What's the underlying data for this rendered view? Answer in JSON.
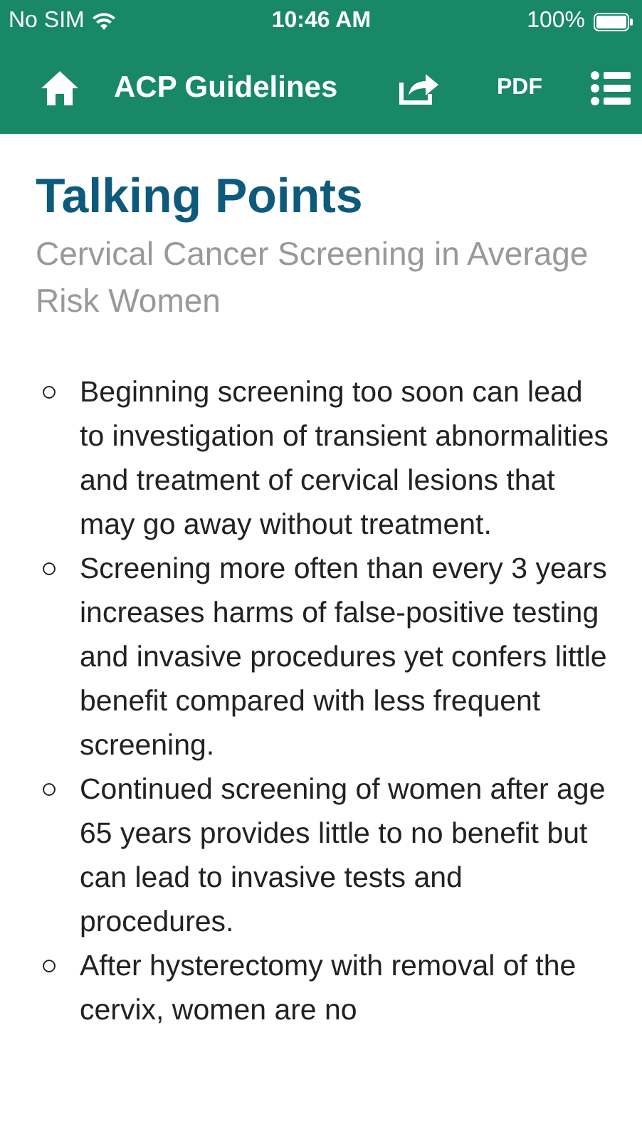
{
  "status_bar": {
    "carrier": "No SIM",
    "time": "10:46 AM",
    "battery": "100%"
  },
  "header": {
    "title": "ACP Guidelines",
    "pdf": "PDF"
  },
  "title": "Talking Points",
  "subtitle": "Cervical Cancer Screening in Average Risk Women",
  "bullets": [
    "Beginning screening too soon can lead to investigation of transient abnormalities and treatment of cervical lesions that may go away without treatment.",
    "Screening more often than every 3 years increases harms of false-positive testing and invasive procedures yet confers little benefit compared with less frequent screening.",
    "Continued screening of women after age 65 years provides little to no benefit but can lead to invasive tests and procedures.",
    "After hysterectomy with removal of the cervix, women are no"
  ]
}
